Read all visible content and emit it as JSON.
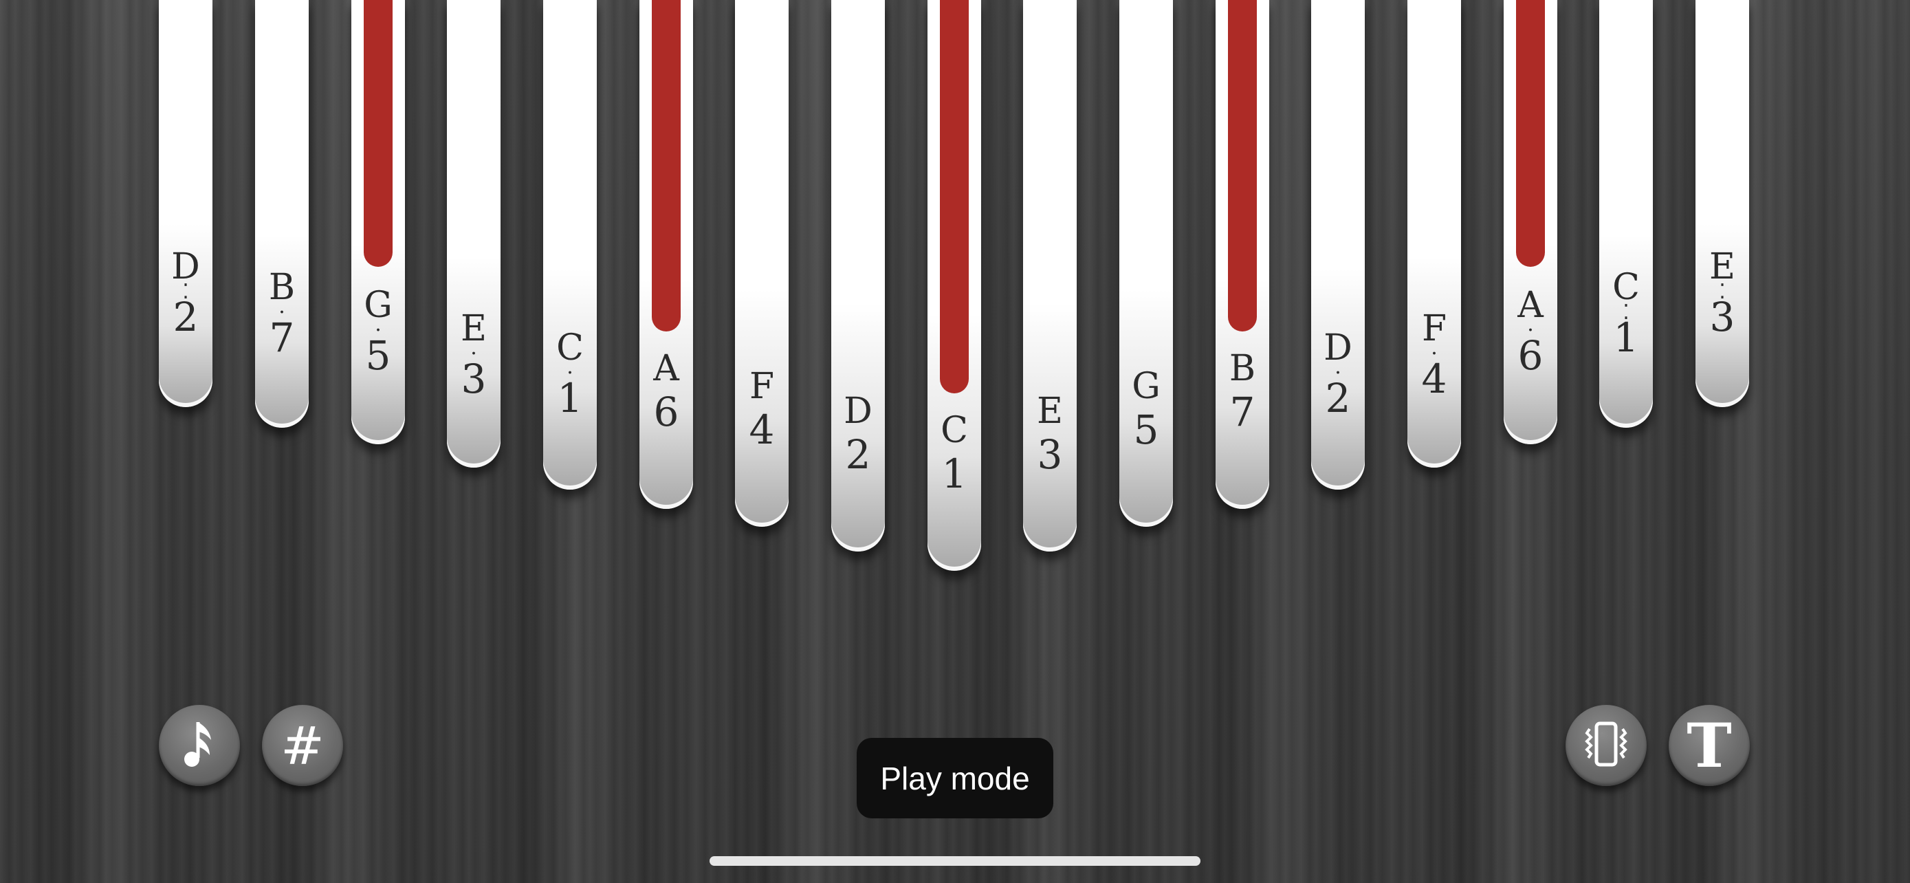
{
  "tines": [
    {
      "letter": "D",
      "dots": "⁚",
      "number": "2",
      "bar": false
    },
    {
      "letter": "B",
      "dots": "·",
      "number": "7",
      "bar": false
    },
    {
      "letter": "G",
      "dots": "·",
      "number": "5",
      "bar": true
    },
    {
      "letter": "E",
      "dots": "·",
      "number": "3",
      "bar": false
    },
    {
      "letter": "C",
      "dots": "·",
      "number": "1",
      "bar": false
    },
    {
      "letter": "A",
      "dots": "",
      "number": "6",
      "bar": true
    },
    {
      "letter": "F",
      "dots": "",
      "number": "4",
      "bar": false
    },
    {
      "letter": "D",
      "dots": "",
      "number": "2",
      "bar": false
    },
    {
      "letter": "C",
      "dots": "",
      "number": "1",
      "bar": true
    },
    {
      "letter": "E",
      "dots": "",
      "number": "3",
      "bar": false
    },
    {
      "letter": "G",
      "dots": "",
      "number": "5",
      "bar": false
    },
    {
      "letter": "B",
      "dots": "",
      "number": "7",
      "bar": true
    },
    {
      "letter": "D",
      "dots": "·",
      "number": "2",
      "bar": false
    },
    {
      "letter": "F",
      "dots": "·",
      "number": "4",
      "bar": false
    },
    {
      "letter": "A",
      "dots": "·",
      "number": "6",
      "bar": true
    },
    {
      "letter": "C",
      "dots": "⁚",
      "number": "1",
      "bar": false
    },
    {
      "letter": "E",
      "dots": "⁚",
      "number": "3",
      "bar": false
    }
  ],
  "toolbar": {
    "notes_icon": "music-note-icon",
    "sharp_label": "#",
    "vibrate_icon": "vibrate-phone-icon",
    "text_label": "T"
  },
  "toast": {
    "label": "Play mode"
  },
  "colors": {
    "bar": "#ad2b26",
    "tine": "#ffffff",
    "wood": "#444444"
  }
}
